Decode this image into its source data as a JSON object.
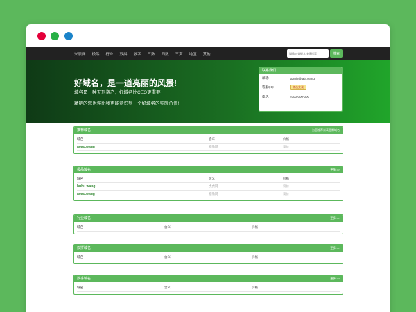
{
  "window": {
    "dots": [
      "#e4003a",
      "#27b045",
      "#1a83c9"
    ]
  },
  "navbar": {
    "links": [
      "米表网",
      "极品",
      "行业",
      "双拼",
      "数字",
      "三数",
      "四数",
      "三声",
      "地区",
      "其他"
    ],
    "search_placeholder": "请输入关键字快速搜索",
    "search_button": "搜索",
    "accent": "#5cb85c"
  },
  "hero": {
    "title": "好域名，是一道亮丽的风景!",
    "subtitle1": "域名是一种无形资产，好域名比CEO更重要",
    "subtitle2": "精明的您也许比我更能意识到一个好域名的实际价值!"
  },
  "contact": {
    "title": "联系我们",
    "rows": [
      {
        "key": "邮箱:",
        "value": "admin@lala.wang"
      },
      {
        "key": "客服QQ:",
        "value": "点击交谈",
        "badge": true
      },
      {
        "key": "电话:",
        "value": "4000-000-000"
      }
    ]
  },
  "columns": {
    "name": "域名",
    "meaning": "含义",
    "price": "价格"
  },
  "panels": [
    {
      "title": "推荐域名",
      "more": "为您推荐米表品牌域名",
      "rows": [
        {
          "name": "aoao.wang",
          "meaning": "嗷嗷网",
          "price": "议价"
        }
      ]
    },
    {
      "title": "极品域名",
      "more": "更多 >>",
      "rows": [
        {
          "name": "huhu.wang",
          "meaning": "虎虎网",
          "price": "议价"
        },
        {
          "name": "aoao.wang",
          "meaning": "嗷嗷网",
          "price": "议价"
        }
      ]
    },
    {
      "title": "行业域名",
      "more": "更多 >>",
      "rows": []
    },
    {
      "title": "双拼域名",
      "more": "更多 >>",
      "rows": []
    },
    {
      "title": "数字域名",
      "more": "更多 >>",
      "rows": []
    }
  ]
}
